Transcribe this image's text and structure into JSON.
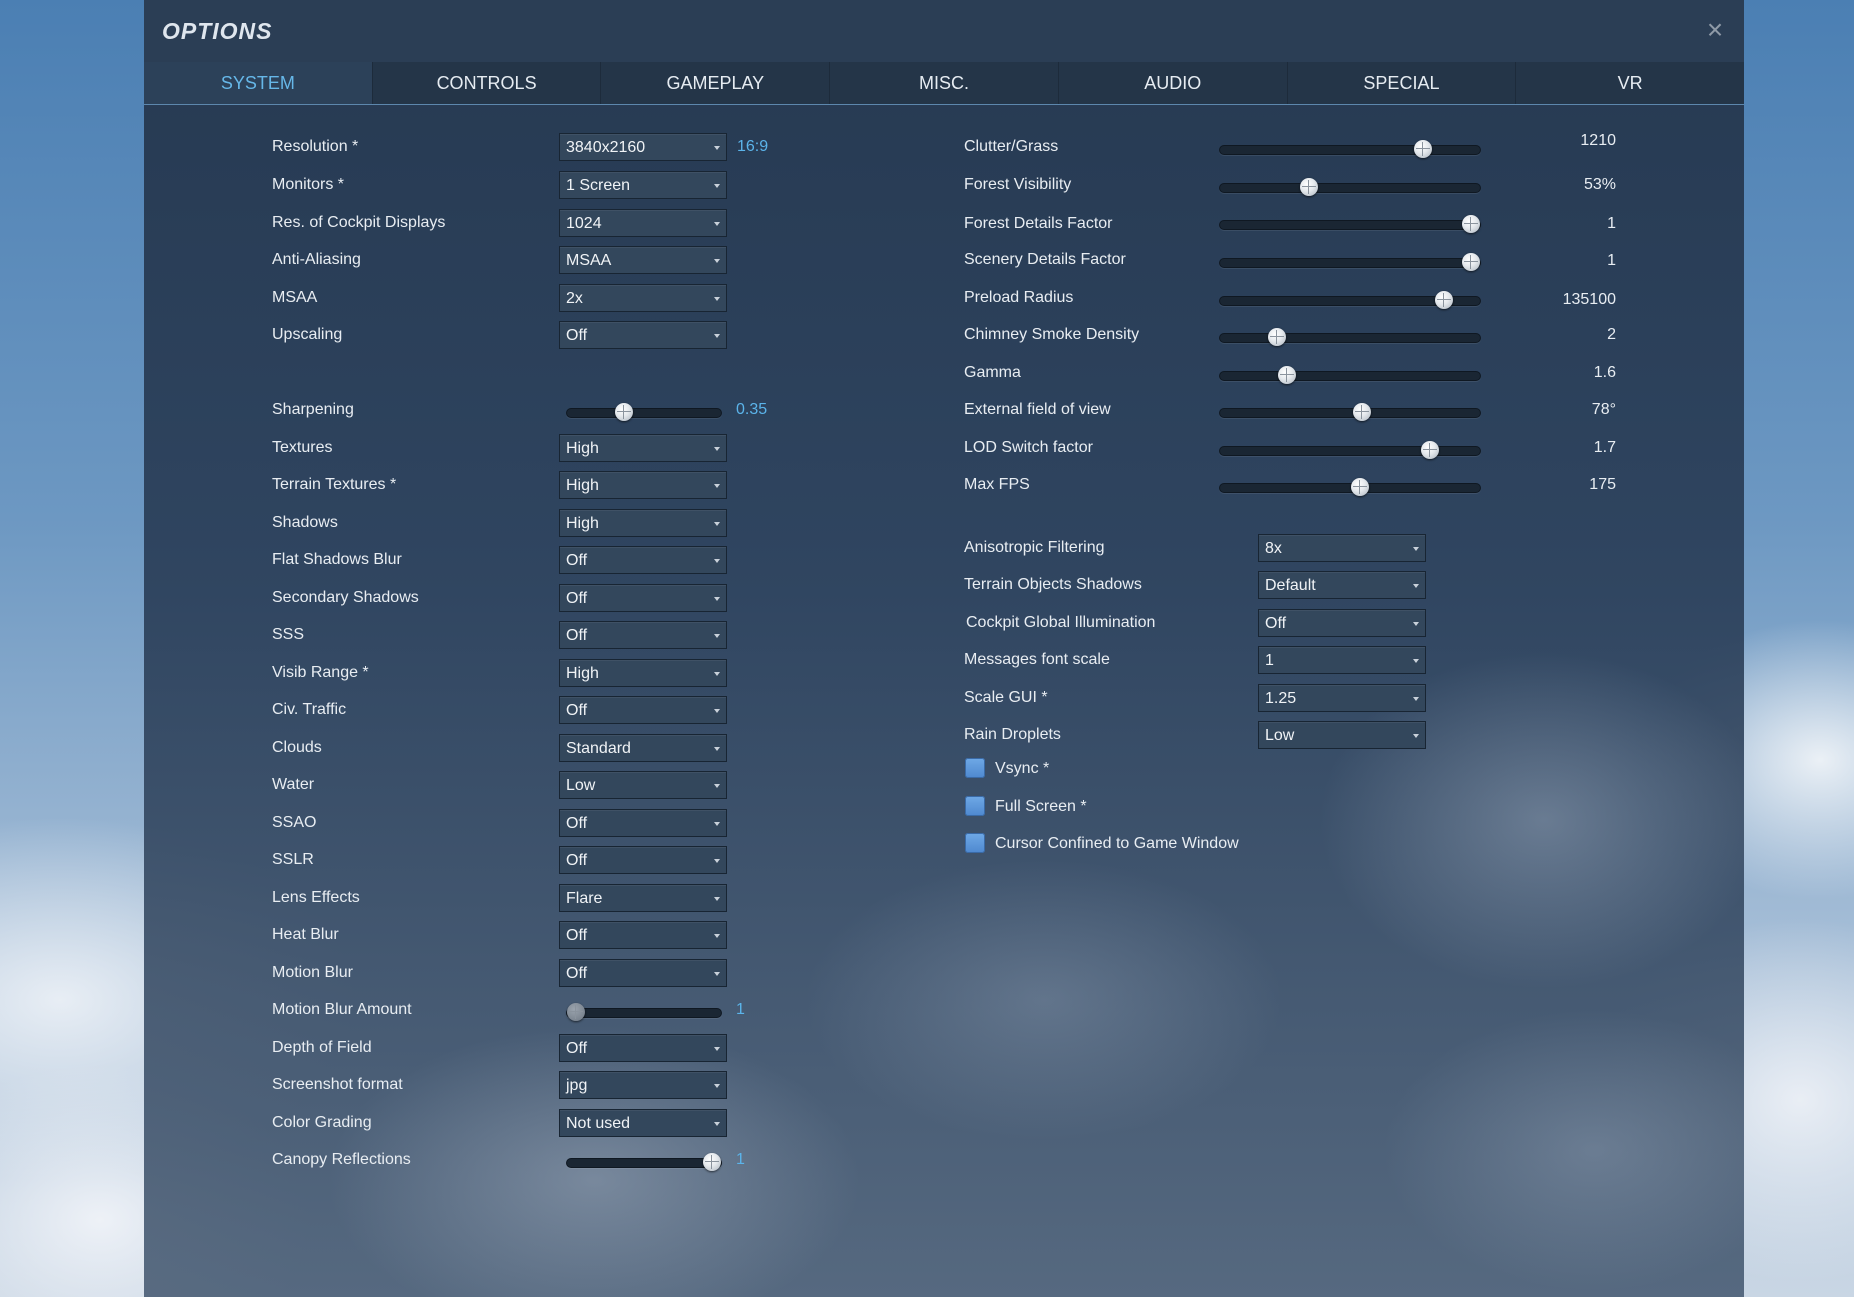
{
  "window": {
    "title": "OPTIONS",
    "close_glyph": "×"
  },
  "tabs": [
    {
      "label": "SYSTEM",
      "active": true
    },
    {
      "label": "CONTROLS"
    },
    {
      "label": "GAMEPLAY"
    },
    {
      "label": "MISC."
    },
    {
      "label": "AUDIO"
    },
    {
      "label": "SPECIAL"
    },
    {
      "label": "VR"
    }
  ],
  "left": {
    "resolution": {
      "label": "Resolution *",
      "value": "3840x2160",
      "aspect": "16:9"
    },
    "monitors": {
      "label": "Monitors *",
      "value": "1 Screen"
    },
    "cockpit_res": {
      "label": "Res. of Cockpit Displays",
      "value": "1024"
    },
    "anti_aliasing": {
      "label": "Anti-Aliasing",
      "value": "MSAA"
    },
    "msaa": {
      "label": "MSAA",
      "value": "2x"
    },
    "upscaling": {
      "label": "Upscaling",
      "value": "Off"
    },
    "sharpening": {
      "label": "Sharpening",
      "value": "0.35",
      "fraction": 0.35
    },
    "textures": {
      "label": "Textures",
      "value": "High"
    },
    "terrain_textures": {
      "label": "Terrain Textures *",
      "value": "High"
    },
    "shadows": {
      "label": "Shadows",
      "value": "High"
    },
    "flat_shadows_blur": {
      "label": "Flat Shadows Blur",
      "value": "Off"
    },
    "secondary_shadows": {
      "label": "Secondary Shadows",
      "value": "Off"
    },
    "sss": {
      "label": "SSS",
      "value": "Off"
    },
    "visib_range": {
      "label": "Visib Range *",
      "value": "High"
    },
    "civ_traffic": {
      "label": "Civ. Traffic",
      "value": "Off"
    },
    "clouds": {
      "label": "Clouds",
      "value": "Standard"
    },
    "water": {
      "label": "Water",
      "value": "Low"
    },
    "ssao": {
      "label": "SSAO",
      "value": "Off"
    },
    "sslr": {
      "label": "SSLR",
      "value": "Off"
    },
    "lens_effects": {
      "label": "Lens Effects",
      "value": "Flare"
    },
    "heat_blur": {
      "label": "Heat Blur",
      "value": "Off"
    },
    "motion_blur": {
      "label": "Motion Blur",
      "value": "Off"
    },
    "motion_blur_amount": {
      "label": "Motion Blur Amount",
      "value": "1",
      "fraction": 0.0
    },
    "depth_of_field": {
      "label": "Depth of Field",
      "value": "Off"
    },
    "screenshot_format": {
      "label": "Screenshot format",
      "value": "jpg"
    },
    "color_grading": {
      "label": "Color Grading",
      "value": "Not used"
    },
    "canopy_reflections": {
      "label": "Canopy Reflections",
      "value": "1",
      "fraction": 1.0
    }
  },
  "right": {
    "clutter_grass": {
      "label": "Clutter/Grass",
      "value": "1210",
      "fraction": 0.8
    },
    "forest_visibility": {
      "label": "Forest Visibility",
      "value": "53%",
      "fraction": 0.33
    },
    "forest_details": {
      "label": "Forest Details Factor",
      "value": "1",
      "fraction": 1.0
    },
    "scenery_details": {
      "label": "Scenery Details Factor",
      "value": "1",
      "fraction": 1.0
    },
    "preload_radius": {
      "label": "Preload Radius",
      "value": "135100",
      "fraction": 0.89
    },
    "chimney_smoke": {
      "label": "Chimney Smoke Density",
      "value": "2",
      "fraction": 0.2
    },
    "gamma": {
      "label": "Gamma",
      "value": "1.6",
      "fraction": 0.24
    },
    "external_fov": {
      "label": "External field of view",
      "value": "78°",
      "fraction": 0.55
    },
    "lod_switch": {
      "label": "LOD Switch factor",
      "value": "1.7",
      "fraction": 0.83
    },
    "max_fps": {
      "label": "Max FPS",
      "value": "175",
      "fraction": 0.54
    },
    "anisotropic": {
      "label": "Anisotropic Filtering",
      "value": "8x"
    },
    "terrain_objects_shadows": {
      "label": "Terrain Objects Shadows",
      "value": "Default"
    },
    "cockpit_gi": {
      "label": "Cockpit Global Illumination",
      "value": "Off"
    },
    "messages_font_scale": {
      "label": "Messages font scale",
      "value": "1"
    },
    "scale_gui": {
      "label": "Scale GUI *",
      "value": "1.25"
    },
    "rain_droplets": {
      "label": "Rain Droplets",
      "value": "Low"
    },
    "vsync": {
      "label": "Vsync *",
      "checked": true
    },
    "full_screen": {
      "label": "Full Screen *",
      "checked": true
    },
    "cursor_confined": {
      "label": "Cursor Confined to Game Window",
      "checked": true
    }
  }
}
